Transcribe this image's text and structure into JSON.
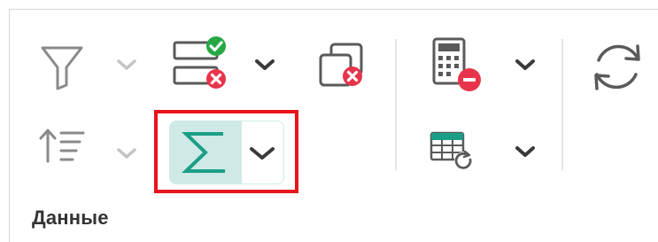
{
  "ribbon": {
    "group_label": "Данные",
    "highlight_color": "#e8141c",
    "accent_color": "#1b9e87",
    "buttons": [
      {
        "id": "filter",
        "icon": "filter-icon",
        "has_dropdown": true,
        "dropdown_state": "disabled"
      },
      {
        "id": "data-validation",
        "icon": "data-validation-icon",
        "has_dropdown": true
      },
      {
        "id": "remove-duplicates",
        "icon": "remove-duplicates-icon",
        "has_dropdown": false
      },
      {
        "id": "sort",
        "icon": "sort-icon",
        "has_dropdown": true,
        "dropdown_state": "disabled"
      },
      {
        "id": "autosum",
        "icon": "sigma-icon",
        "has_dropdown": true,
        "state": "highlighted"
      },
      {
        "id": "calculation-off",
        "icon": "calculator-stop-icon",
        "has_dropdown": true
      },
      {
        "id": "recalculate",
        "icon": "table-refresh-icon",
        "has_dropdown": true
      },
      {
        "id": "refresh",
        "icon": "refresh-icon",
        "has_dropdown": false
      }
    ]
  }
}
